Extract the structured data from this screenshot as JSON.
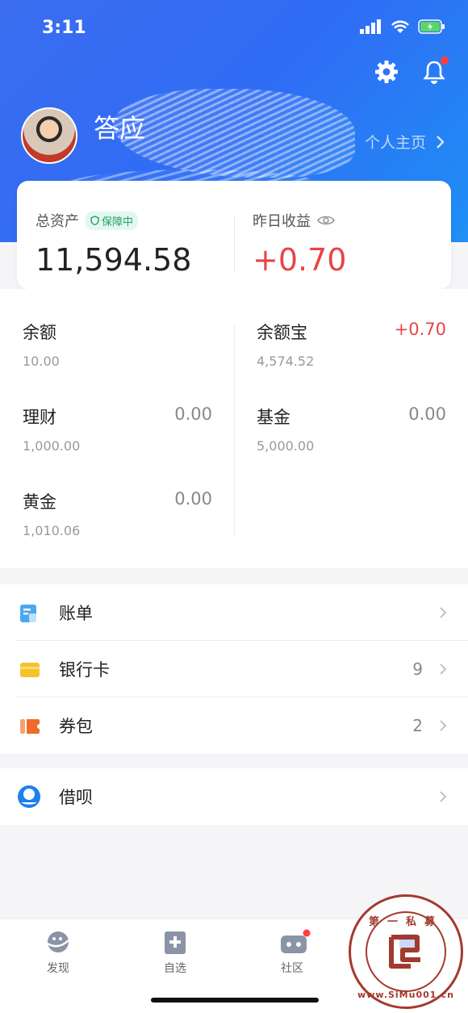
{
  "status": {
    "time": "3:11"
  },
  "profile": {
    "name": "答应",
    "home_link": "个人主页"
  },
  "assets": {
    "total_label": "总资产",
    "badge": "保障中",
    "total_value": "11,594.58",
    "yesterday_label": "昨日收益",
    "yesterday_value": "+0.70"
  },
  "wealth": [
    {
      "name": "余额",
      "amount": "",
      "sub": "10.00"
    },
    {
      "name": "余额宝",
      "amount": "+0.70",
      "sub": "4,574.52"
    },
    {
      "name": "理财",
      "amount": "0.00",
      "sub": "1,000.00"
    },
    {
      "name": "基金",
      "amount": "0.00",
      "sub": "5,000.00"
    },
    {
      "name": "黄金",
      "amount": "0.00",
      "sub": "1,010.06"
    }
  ],
  "menu1": [
    {
      "label": "账单",
      "count": ""
    },
    {
      "label": "银行卡",
      "count": "9"
    },
    {
      "label": "券包",
      "count": "2"
    }
  ],
  "menu2": [
    {
      "label": "借呗",
      "count": ""
    }
  ],
  "tabs": [
    {
      "label": "发现"
    },
    {
      "label": "自选"
    },
    {
      "label": "社区"
    }
  ],
  "watermark": {
    "top": "第一私募",
    "bottom": "www.SiMu001.cn"
  },
  "colors": {
    "accent": "#2f6df5",
    "positive": "#e64545",
    "badge": "#1fa36a"
  }
}
